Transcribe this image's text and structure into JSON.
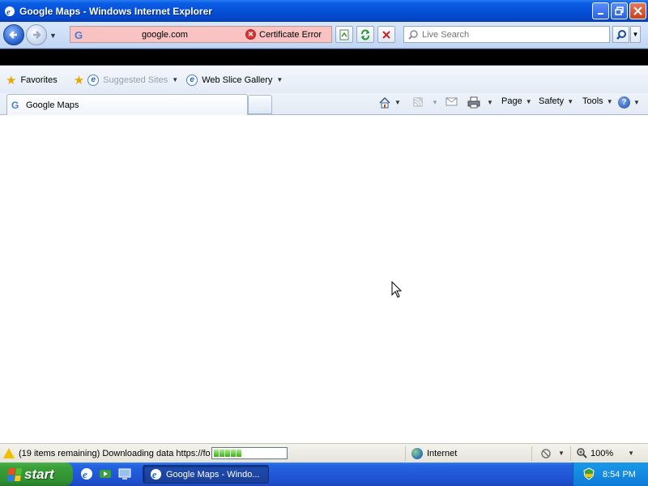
{
  "window": {
    "title": "Google Maps - Windows Internet Explorer"
  },
  "address_bar": {
    "url": "google.com",
    "security_status": "Certificate Error",
    "search_placeholder": "Live Search"
  },
  "favorites_bar": {
    "favorites_label": "Favorites",
    "items": [
      {
        "label": "Suggested Sites"
      },
      {
        "label": "Web Slice Gallery"
      }
    ]
  },
  "tabs": [
    {
      "label": "Google Maps"
    }
  ],
  "command_bar": {
    "page_label": "Page",
    "safety_label": "Safety",
    "tools_label": "Tools"
  },
  "status_bar": {
    "text": "(19 items remaining) Downloading data https://fo",
    "progress_fraction": 0.45,
    "zone": "Internet",
    "zoom": "100%"
  },
  "taskbar": {
    "start_label": "start",
    "active_window": "Google Maps - Windo...",
    "clock": "8:54 PM"
  },
  "colors": {
    "titlebar": "#0550d8",
    "cert_error_bg": "#f9c3c3",
    "taskbar": "#2158d8",
    "start_button": "#3aa03a"
  }
}
